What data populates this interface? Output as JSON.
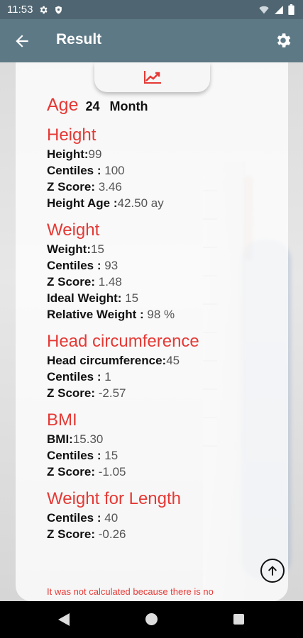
{
  "status_bar": {
    "time": "11:53"
  },
  "app_bar": {
    "title": "Result"
  },
  "age": {
    "label": "Age",
    "value": "24",
    "unit": "Month"
  },
  "sections": {
    "height": {
      "title": "Height",
      "rows": [
        {
          "label": "Height:",
          "value": "99"
        },
        {
          "label": "Centiles : ",
          "value": "100"
        },
        {
          "label": "Z Score: ",
          "value": "3.46"
        },
        {
          "label": "Height Age :",
          "value": "42.50 ay"
        }
      ]
    },
    "weight": {
      "title": "Weight",
      "rows": [
        {
          "label": "Weight:",
          "value": "15"
        },
        {
          "label": "Centiles : ",
          "value": "93"
        },
        {
          "label": "Z Score: ",
          "value": "1.48"
        },
        {
          "label": "Ideal Weight: ",
          "value": "15"
        },
        {
          "label": "Relative Weight : ",
          "value": "98 %"
        }
      ]
    },
    "head": {
      "title": "Head circumference",
      "rows": [
        {
          "label": "Head circumference:",
          "value": "45"
        },
        {
          "label": "Centiles : ",
          "value": "1"
        },
        {
          "label": "Z Score: ",
          "value": "-2.57"
        }
      ]
    },
    "bmi": {
      "title": "BMI",
      "rows": [
        {
          "label": "BMI:",
          "value": "15.30"
        },
        {
          "label": "Centiles : ",
          "value": "15"
        },
        {
          "label": "Z Score: ",
          "value": "-1.05"
        }
      ]
    },
    "wfl": {
      "title": "Weight for Length",
      "rows": [
        {
          "label": "Centiles : ",
          "value": "40"
        },
        {
          "label": "Z Score: ",
          "value": "-0.26"
        }
      ]
    }
  },
  "note": "It was not calculated because there is no",
  "colors": {
    "accent": "#e53935",
    "app_bar": "#5e7986",
    "status_bar": "#4f6571"
  },
  "icons": {
    "tab": "trending-up-icon",
    "back": "arrow-back-icon",
    "settings": "gear-icon",
    "scroll_top": "arrow-up-circle-icon"
  }
}
